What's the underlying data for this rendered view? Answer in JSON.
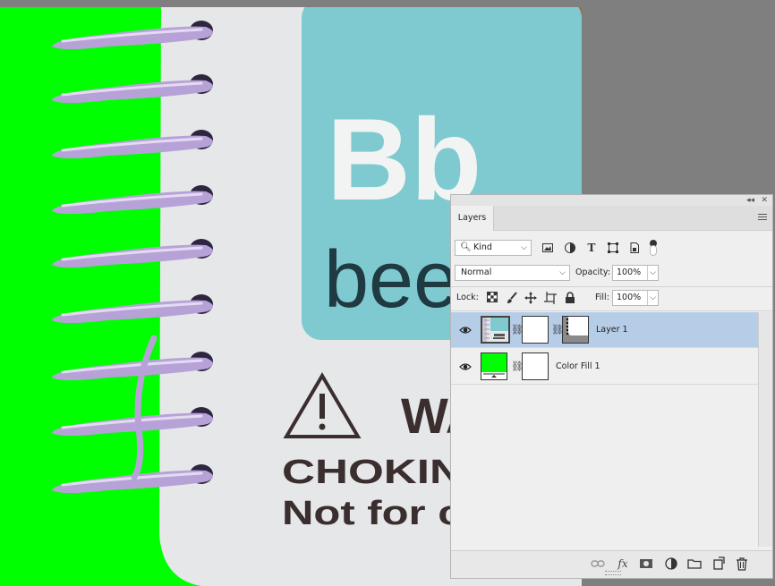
{
  "canvas": {
    "colors": {
      "green": "#00ff00",
      "teal": "#7ecad0",
      "page": "#e6e7e9",
      "coil": "#b7a2d8"
    },
    "artwork": {
      "big_letters": "Bb",
      "small_word": "bee",
      "warning_title": "WA",
      "warning_line1": "CHOKING HA",
      "warning_line2": "Not for childre"
    }
  },
  "layers_panel": {
    "tab_label": "Layers",
    "filter": {
      "kind_label": "Kind"
    },
    "blend_mode": "Normal",
    "opacity_label": "Opacity:",
    "opacity_value": "100%",
    "lock_label": "Lock:",
    "fill_label": "Fill:",
    "fill_value": "100%",
    "layers": [
      {
        "name": "Layer 1",
        "selected": true,
        "visible": true
      },
      {
        "name": "Color Fill 1",
        "selected": false,
        "visible": true
      }
    ],
    "footer_icons": [
      "link-icon",
      "fx-icon",
      "mask-icon",
      "adjustment-icon",
      "folder-icon",
      "new-layer-icon",
      "trash-icon"
    ],
    "selection_color": "#b6cde8"
  }
}
